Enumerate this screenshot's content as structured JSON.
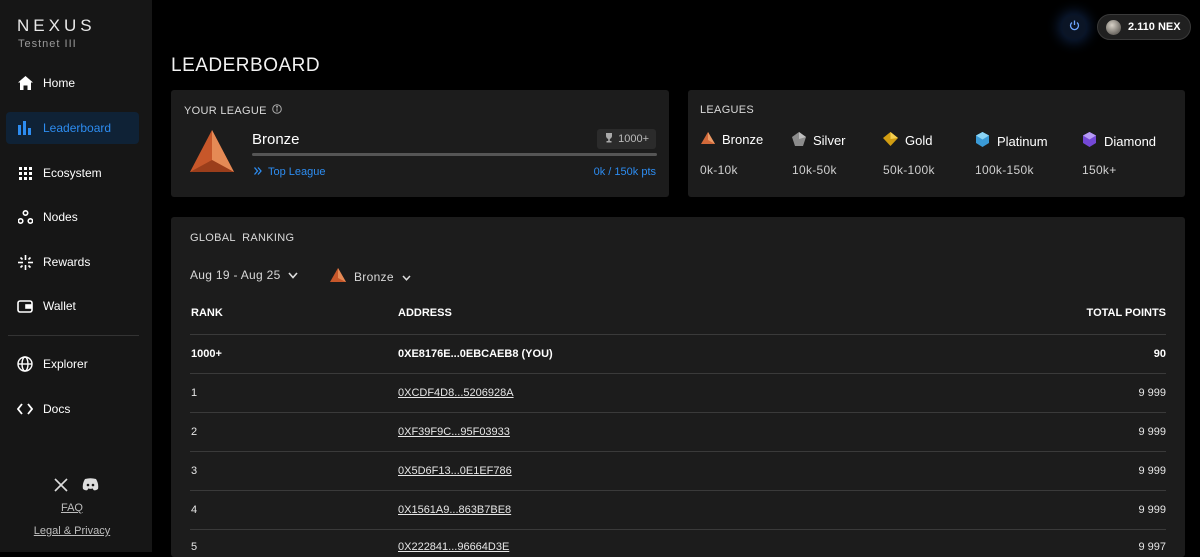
{
  "brand": {
    "name": "NEXUS",
    "subtitle": "Testnet III"
  },
  "sidebar": {
    "items": [
      {
        "label": "Home",
        "icon": "home-icon"
      },
      {
        "label": "Leaderboard",
        "icon": "bar-chart-icon",
        "active": true
      },
      {
        "label": "Ecosystem",
        "icon": "grid-icon"
      },
      {
        "label": "Nodes",
        "icon": "nodes-icon"
      },
      {
        "label": "Rewards",
        "icon": "sparkle-icon"
      },
      {
        "label": "Wallet",
        "icon": "wallet-icon"
      }
    ],
    "secondary": [
      {
        "label": "Explorer",
        "icon": "globe-icon"
      },
      {
        "label": "Docs",
        "icon": "code-icon"
      }
    ],
    "footer": {
      "faq": "FAQ",
      "legal": "Legal & Privacy"
    }
  },
  "header": {
    "balance": "2.110 NEX"
  },
  "page_title": "LEADERBOARD",
  "your_league": {
    "label": "YOUR LEAGUE",
    "league": "Bronze",
    "rank_badge": "1000+",
    "progress_fraction": 0.0,
    "top_league_link": "Top League",
    "points_text": "0k / 150k pts"
  },
  "leagues": {
    "label": "LEAGUES",
    "tiers": [
      {
        "name": "Bronze",
        "range": "0k-10k",
        "color": "#d2693a"
      },
      {
        "name": "Silver",
        "range": "10k-50k",
        "color": "#9a9a9a"
      },
      {
        "name": "Gold",
        "range": "50k-100k",
        "color": "#e6b422"
      },
      {
        "name": "Platinum",
        "range": "100k-150k",
        "color": "#4fb4e8"
      },
      {
        "name": "Diamond",
        "range": "150k+",
        "color": "#8a5ce6"
      }
    ]
  },
  "ranking": {
    "label": "GLOBAL  RANKING",
    "week_filter": "Aug 19 - Aug 25",
    "league_filter": "Bronze",
    "columns": {
      "rank": "RANK",
      "address": "ADDRESS",
      "points": "TOTAL POINTS"
    },
    "you": {
      "rank": "1000+",
      "address": "0XE8176E...0EBCAEB8 (YOU)",
      "points": "90"
    },
    "rows": [
      {
        "rank": "1",
        "address": "0XCDF4D8...5206928A",
        "points": "9 999"
      },
      {
        "rank": "2",
        "address": "0XF39F9C...95F03933",
        "points": "9 999"
      },
      {
        "rank": "3",
        "address": "0X5D6F13...0E1EF786",
        "points": "9 999"
      },
      {
        "rank": "4",
        "address": "0X1561A9...863B7BE8",
        "points": "9 999"
      },
      {
        "rank": "5",
        "address": "0X222841...96664D3E",
        "points": "9 997"
      }
    ]
  }
}
